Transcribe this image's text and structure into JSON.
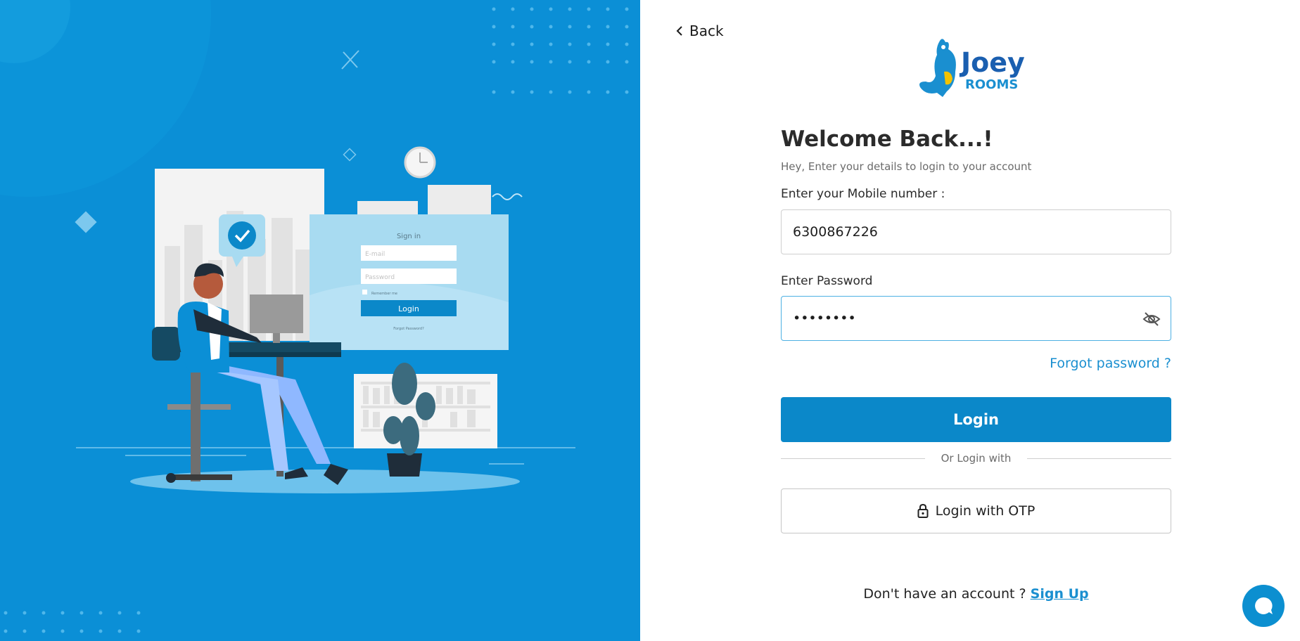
{
  "nav": {
    "back_label": "Back"
  },
  "brand": {
    "logo_line1": "Joey",
    "logo_line2": "ROOMS"
  },
  "form": {
    "title": "Welcome Back...!",
    "subtitle": "Hey, Enter your details to login to your account",
    "mobile_label": "Enter your Mobile number :",
    "mobile_value": "6300867226",
    "password_label": "Enter Password",
    "password_value": "••••••••",
    "forgot_label": "Forgot password ?",
    "login_label": "Login",
    "divider_label": "Or Login with",
    "otp_label": "Login with OTP"
  },
  "footer": {
    "prompt": "Don't have an account ?",
    "signup_label": "Sign Up"
  },
  "illustration": {
    "signin_title": "Sign in",
    "email_placeholder": "E-mail",
    "password_placeholder": "Password",
    "remember_label": "Remember me",
    "login_label": "Login",
    "forgot_label": "Forgot Password?"
  },
  "colors": {
    "panel": "#0b8fd6",
    "accent": "#0b88c9",
    "link": "#1a8fd0"
  }
}
